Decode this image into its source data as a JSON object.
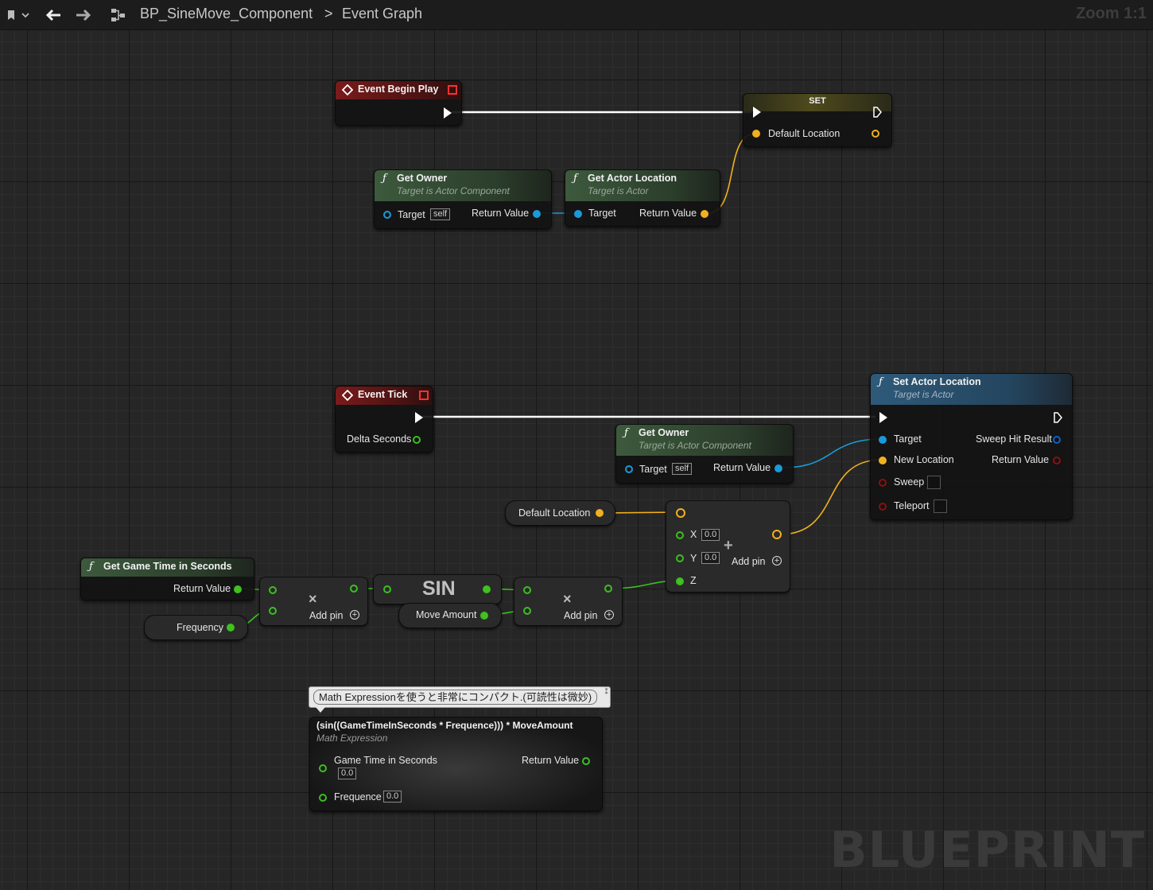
{
  "toolbar": {
    "breadcrumb_asset": "BP_SineMove_Component",
    "breadcrumb_separator": ">",
    "breadcrumb_graph": "Event Graph",
    "zoom": "Zoom 1:1",
    "icons": [
      "bookmark-icon",
      "chevron-down-icon",
      "back-arrow-icon",
      "forward-arrow-icon",
      "graph-icon"
    ]
  },
  "watermark": "BLUEPRINT",
  "colors": {
    "exec": "#ffffff",
    "vector": "#f0b020",
    "float": "#3ac020",
    "object": "#1a9ad8",
    "bool": "#8a1010",
    "struct": "#1060c8"
  },
  "nodes": {
    "begin_play": {
      "title": "Event Begin Play"
    },
    "set_node": {
      "title": "SET",
      "pin": "Default Location"
    },
    "get_owner1": {
      "title": "Get Owner",
      "subtitle": "Target is Actor Component",
      "in_pin": "Target",
      "self": "self",
      "out_pin": "Return Value"
    },
    "get_actor_location": {
      "title": "Get Actor Location",
      "subtitle": "Target is Actor",
      "in_pin": "Target",
      "out_pin": "Return Value"
    },
    "event_tick": {
      "title": "Event Tick",
      "out_pin": "Delta Seconds"
    },
    "set_actor_location": {
      "title": "Set Actor Location",
      "subtitle": "Target is Actor",
      "pins_in": [
        "Target",
        "New Location",
        "Sweep",
        "Teleport"
      ],
      "pins_out": [
        "Sweep Hit Result",
        "Return Value"
      ]
    },
    "get_owner2": {
      "title": "Get Owner",
      "subtitle": "Target is Actor Component",
      "in_pin": "Target",
      "self": "self",
      "out_pin": "Return Value"
    },
    "default_location_var": {
      "label": "Default Location"
    },
    "add_vector": {
      "x_label": "X",
      "x_val": "0.0",
      "y_label": "Y",
      "y_val": "0.0",
      "z_label": "Z",
      "add_pin": "Add pin",
      "plus": "+"
    },
    "game_time": {
      "title": "Get Game Time in Seconds",
      "out_pin": "Return Value"
    },
    "frequency_var": {
      "label": "Frequency"
    },
    "multiply1": {
      "symbol": "×",
      "add_pin": "Add pin"
    },
    "sin": {
      "label": "SIN"
    },
    "move_amount_var": {
      "label": "Move Amount"
    },
    "multiply2": {
      "symbol": "×",
      "add_pin": "Add pin"
    },
    "comment": {
      "text": "Math Expressionを使うと非常にコンパクト.(可読性は微妙)"
    },
    "math_expr": {
      "title": "(sin((GameTimeInSeconds * Frequence))) * MoveAmount",
      "subtitle": "Math Expression",
      "in1": "Game Time in Seconds",
      "in1_val": "0.0",
      "in2": "Frequence",
      "in2_val": "0.0",
      "out": "Return Value"
    }
  }
}
